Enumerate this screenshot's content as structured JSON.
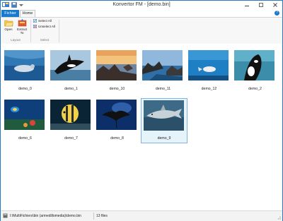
{
  "window": {
    "title": "Konvertor FM - [demo.bin]"
  },
  "ribbon": {
    "tabs": {
      "file": "Fichier",
      "home": "Home"
    },
    "layout_group": {
      "label": "Layout",
      "open": "Open",
      "extract": "Extract To"
    },
    "select_group": {
      "label": "Select",
      "select_all": "Select All",
      "unselect_all": "Unselect All"
    }
  },
  "files": [
    {
      "name": "demo_0",
      "scene": "seal"
    },
    {
      "name": "demo_1",
      "scene": "orca-jump"
    },
    {
      "name": "demo_10",
      "scene": "sunset-coast"
    },
    {
      "name": "demo_11",
      "scene": "coast-rocks"
    },
    {
      "name": "demo_12",
      "scene": "diver-blue"
    },
    {
      "name": "demo_2",
      "scene": "orca-water"
    },
    {
      "name": "demo_6",
      "scene": "reef-fish"
    },
    {
      "name": "demo_7",
      "scene": "angelfish"
    },
    {
      "name": "demo_8",
      "scene": "manta-ray"
    },
    {
      "name": "demo_9",
      "scene": "shark",
      "selected": true
    }
  ],
  "status": {
    "path": "I:\\MultiFichiers\\bin (armedillomedia)\\demo.bin",
    "count": "13 files"
  },
  "colors": {
    "accent": "#1979ca",
    "selection_bg": "#e5f3fb",
    "selection_border": "#7eb4de"
  }
}
